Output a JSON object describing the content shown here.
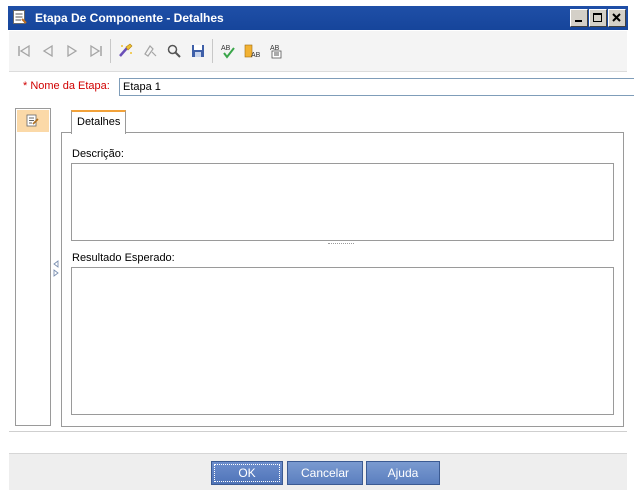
{
  "window": {
    "title": "Etapa De Componente - Detalhes",
    "buttons": [
      "minimize-icon",
      "maximize-icon",
      "close-icon"
    ]
  },
  "toolbar": {
    "items": [
      {
        "icon": "first-record-icon",
        "enabled": false
      },
      {
        "icon": "previous-record-icon",
        "enabled": false
      },
      {
        "icon": "next-record-icon",
        "enabled": false
      },
      {
        "icon": "last-record-icon",
        "enabled": false
      },
      {
        "icon": "clear-icon",
        "enabled": true
      },
      {
        "icon": "insert-parameter-icon",
        "enabled": false
      },
      {
        "icon": "search-icon",
        "enabled": true
      },
      {
        "icon": "save-icon",
        "enabled": true
      },
      {
        "icon": "spell-check-icon",
        "enabled": true
      },
      {
        "icon": "thesaurus-icon",
        "enabled": true
      },
      {
        "icon": "spelling-options-icon",
        "enabled": true
      }
    ]
  },
  "form": {
    "name_label": "* Nome da Etapa:",
    "name_value": "Etapa 1"
  },
  "tabs": [
    {
      "label": "Detalhes",
      "active": true
    }
  ],
  "details": {
    "description_label": "Descrição:",
    "description_value": "",
    "expected_label": "Resultado Esperado:",
    "expected_value": ""
  },
  "footer": {
    "ok_label": "OK",
    "cancel_label": "Cancelar",
    "help_label": "Ajuda"
  },
  "colors": {
    "title_bar": "#16459b",
    "required_label": "#d00000",
    "tab_accent": "#f2a23a",
    "button_blue": "#5b7fbf"
  }
}
